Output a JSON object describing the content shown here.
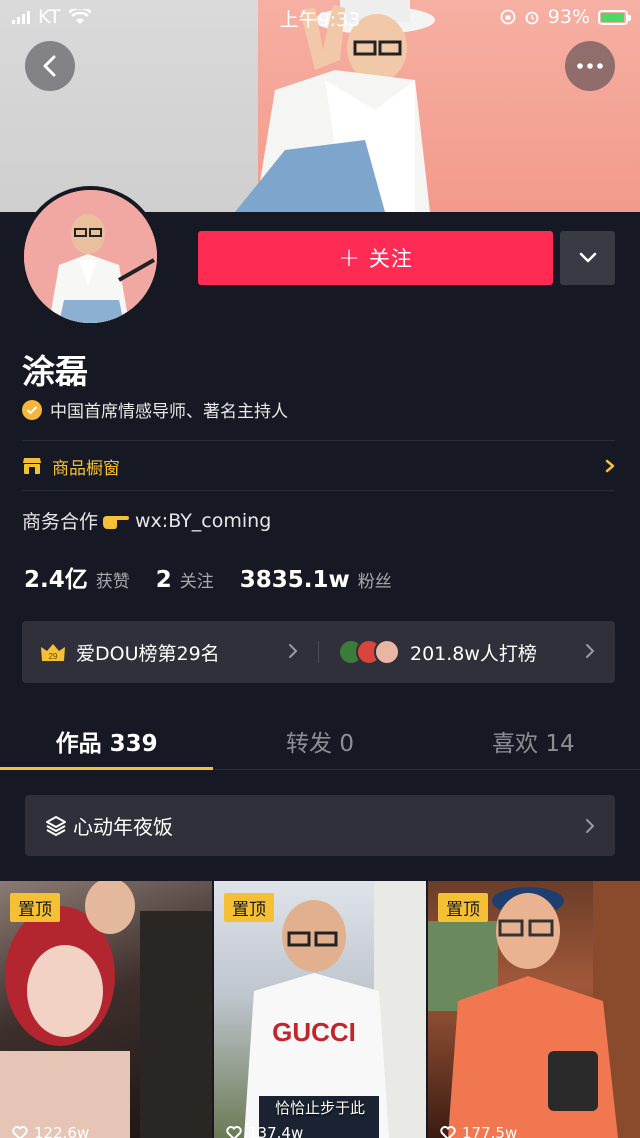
{
  "status_bar": {
    "carrier": "KT",
    "time": "上午9:33",
    "battery": "93%"
  },
  "header": {
    "back_icon": "chevron-left-icon",
    "more_icon": "ellipsis-icon"
  },
  "profile": {
    "follow_label": "关注",
    "nickname": "涂磊",
    "verification": "中国首席情感导师、著名主持人",
    "shop_label": "商品橱窗",
    "bio_prefix": "商务合作",
    "bio_suffix": "wx:BY_coming",
    "stats": [
      {
        "value": "2.4亿",
        "label": "获赞"
      },
      {
        "value": "2",
        "label": "关注"
      },
      {
        "value": "3835.1w",
        "label": "粉丝"
      }
    ],
    "rank_badge": "29",
    "rank_text": "爱DOU榜第29名",
    "fans_cheer": "201.8w人打榜"
  },
  "tabs": [
    {
      "label": "作品 339",
      "active": true
    },
    {
      "label": "转发 0",
      "active": false
    },
    {
      "label": "喜欢 14",
      "active": false
    }
  ],
  "collection": {
    "label": "心动年夜饭"
  },
  "videos": [
    {
      "pin": "置顶",
      "likes": "122.6w",
      "caption": ""
    },
    {
      "pin": "置顶",
      "likes": "137.4w",
      "caption": "恰恰止步于此"
    },
    {
      "pin": "置顶",
      "likes": "177.5w",
      "caption": ""
    }
  ],
  "colors": {
    "background": "#161823",
    "follow": "#fe2c55",
    "accent": "#f5c033",
    "card": "#2f3039"
  }
}
